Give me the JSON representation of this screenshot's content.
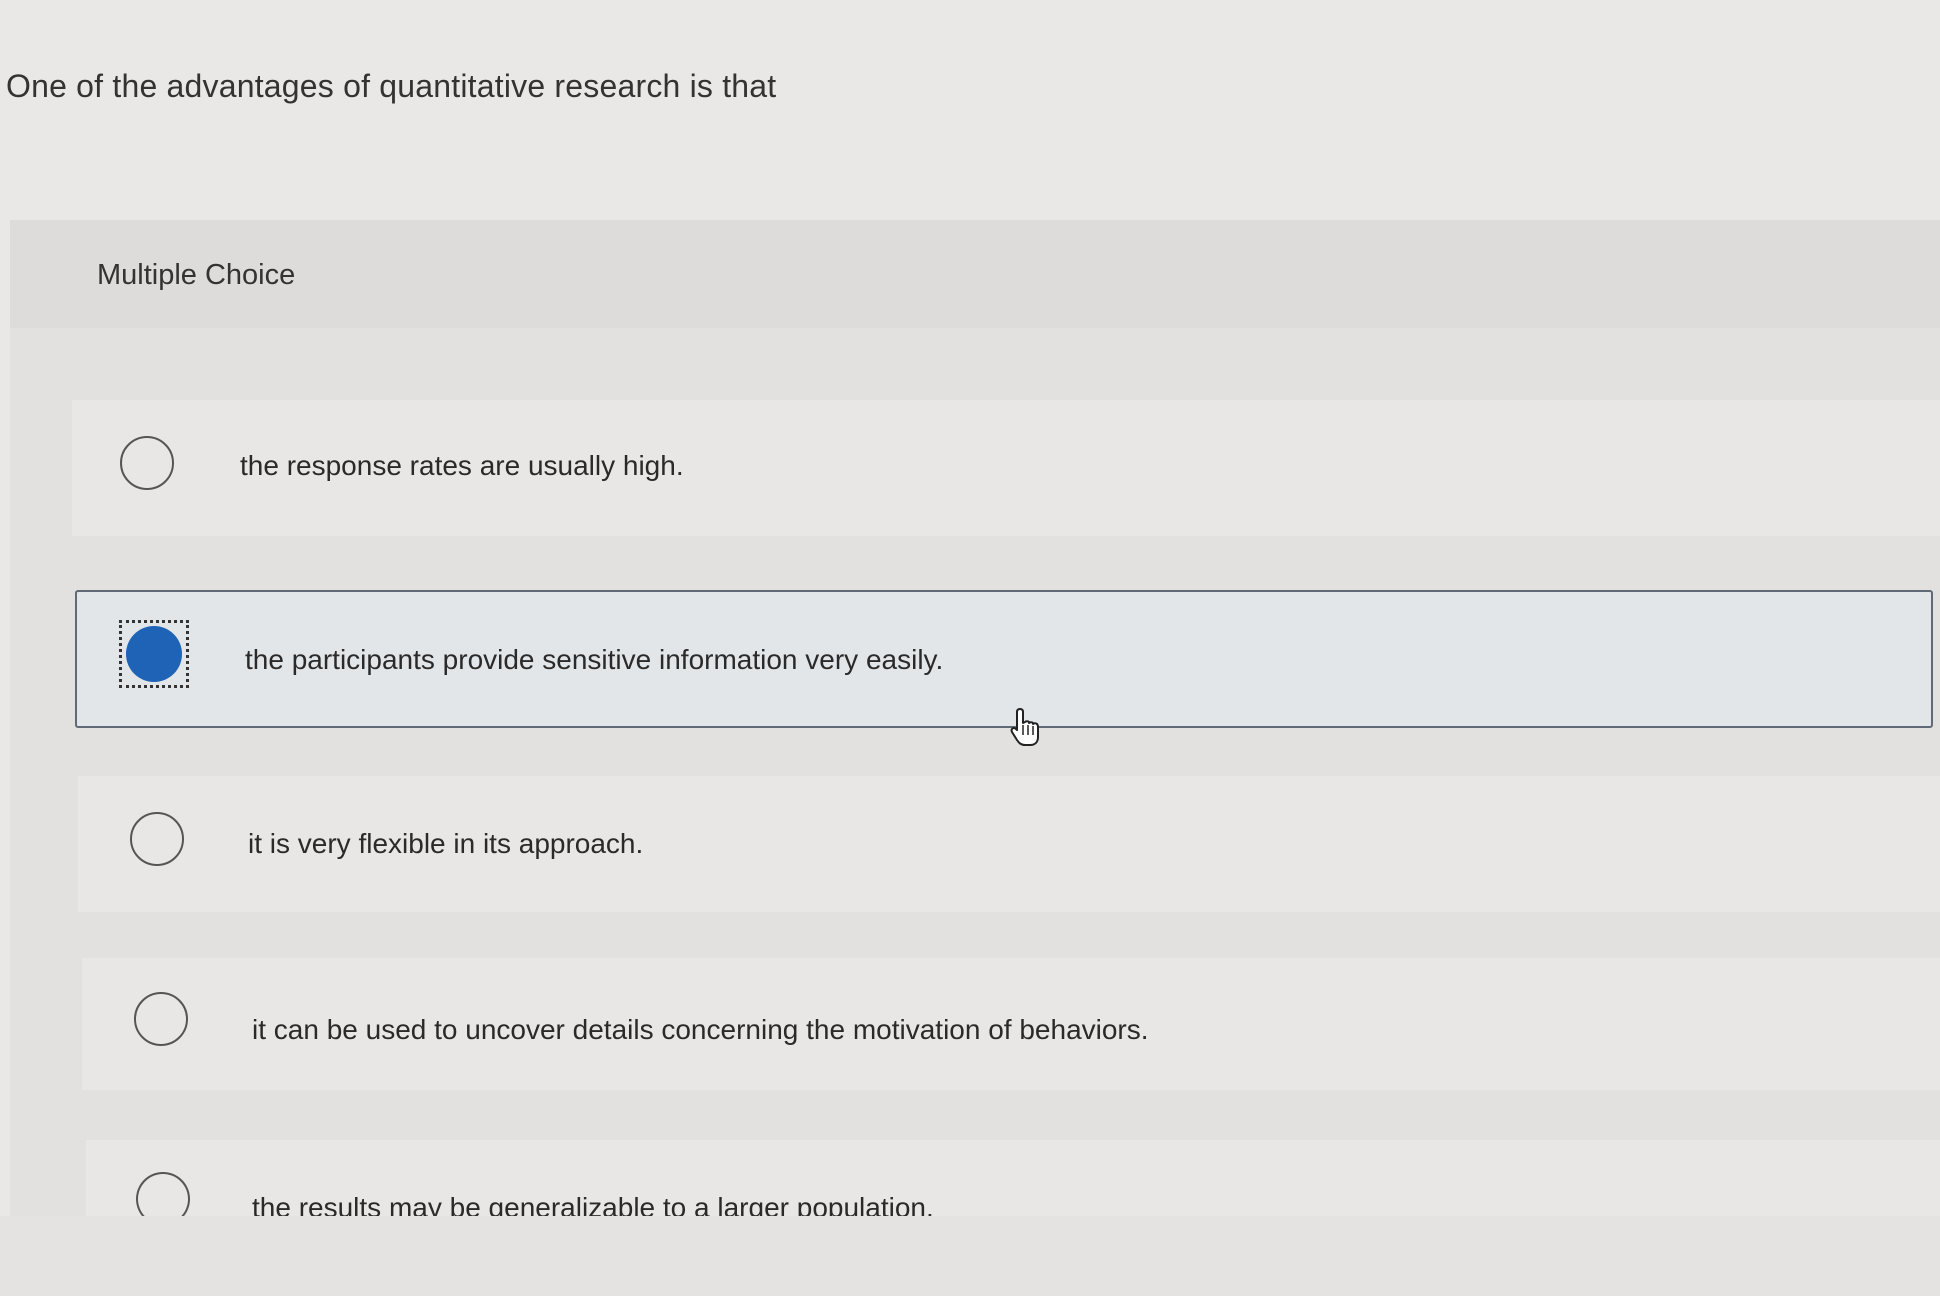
{
  "question": {
    "text": "One of the advantages of quantitative research is that"
  },
  "panel": {
    "label": "Multiple Choice"
  },
  "options": [
    {
      "text": "the response rates are usually high.",
      "selected": false
    },
    {
      "text": "the participants provide sensitive information very easily.",
      "selected": true
    },
    {
      "text": "it is very flexible in its approach.",
      "selected": false
    },
    {
      "text": "it can be used to uncover details concerning the motivation of behaviors.",
      "selected": false
    },
    {
      "text": "the results may be generalizable to a larger population.",
      "selected": false
    }
  ],
  "colors": {
    "accent": "#1f63b6",
    "selected_border": "#5f6a76",
    "background": "#e9e8e6"
  },
  "icons": {
    "cursor": "hand-pointer-icon",
    "radio": "radio-circle-icon"
  }
}
